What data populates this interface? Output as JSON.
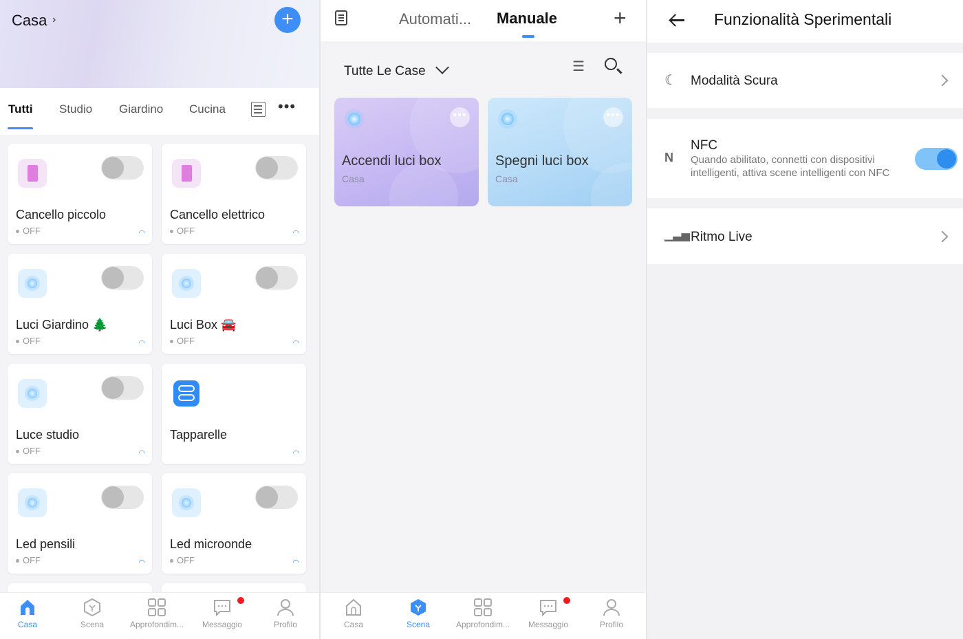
{
  "home": {
    "title": "Casa",
    "tabs": [
      "Tutti",
      "Studio",
      "Giardino",
      "Cucina"
    ],
    "devices": [
      {
        "name": "Cancello piccolo",
        "status": "OFF",
        "icon": "door-icon"
      },
      {
        "name": "Cancello elettrico",
        "status": "OFF",
        "icon": "door-icon"
      },
      {
        "name": "Luci Giardino 🌲",
        "status": "OFF",
        "icon": "bulb-icon"
      },
      {
        "name": "Luci Box 🚘",
        "status": "OFF",
        "icon": "bulb-icon"
      },
      {
        "name": "Luce studio",
        "status": "OFF",
        "icon": "bulb-icon"
      },
      {
        "name": "Tapparelle",
        "status": "",
        "icon": "switch-icon"
      },
      {
        "name": "Led pensili",
        "status": "OFF",
        "icon": "bulb-icon"
      },
      {
        "name": "Led microonde",
        "status": "OFF",
        "icon": "bulb-icon"
      }
    ]
  },
  "bottom_nav": [
    "Casa",
    "Scena",
    "Approfondim...",
    "Messaggio",
    "Profilo"
  ],
  "scenes": {
    "tabs": [
      "Automati...",
      "Manuale"
    ],
    "filter": "Tutte Le Case",
    "cards": [
      {
        "name": "Accendi luci box",
        "home": "Casa"
      },
      {
        "name": "Spegni luci box",
        "home": "Casa"
      }
    ]
  },
  "settings": {
    "title": "Funzionalità Sperimentali",
    "dark_mode": "Modalità Scura",
    "nfc": {
      "label": "NFC",
      "description": "Quando abilitato, connetti con dispositivi intelligenti, attiva scene intelligenti con NFC",
      "enabled": true
    },
    "live_rhythm": "Ritmo Live"
  },
  "colors": {
    "accent": "#3e8ef7",
    "badge": "#f01c1c"
  }
}
